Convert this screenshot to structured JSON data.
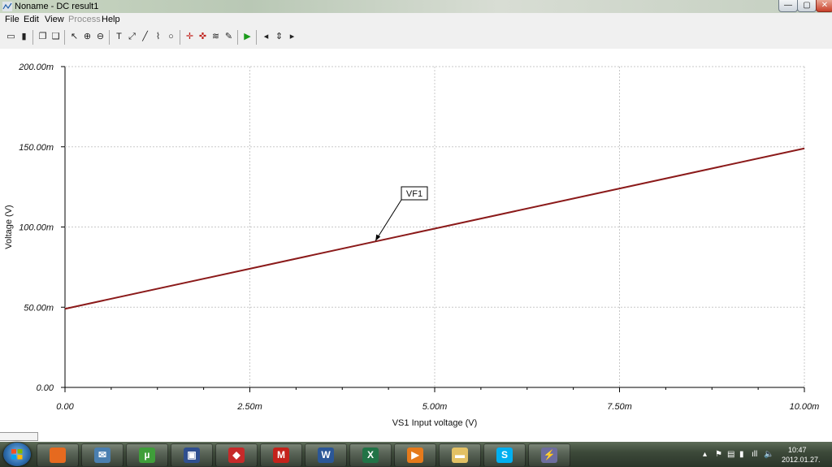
{
  "window": {
    "title": "Noname - DC result1",
    "buttons": {
      "minimize": "—",
      "maximize": "▢",
      "close": "✕"
    }
  },
  "menu": {
    "items": [
      {
        "label": "File",
        "enabled": true
      },
      {
        "label": "Edit",
        "enabled": true
      },
      {
        "label": "View",
        "enabled": true
      },
      {
        "label": "Process",
        "enabled": false
      },
      {
        "label": "Help",
        "enabled": true
      }
    ]
  },
  "toolbar": {
    "icons": [
      "open-icon",
      "save-icon",
      "copy-icon",
      "paste-icon",
      "pointer-icon",
      "zoom-in-icon",
      "zoom-out-icon",
      "text-icon",
      "marker-icon",
      "line-icon",
      "cursor-line-icon",
      "circle-icon",
      "cross-cursor-icon",
      "cursor-pair-icon",
      "curve-icon",
      "probe-icon",
      "run-icon",
      "step-back-icon",
      "step-updown-icon",
      "step-forward-icon"
    ],
    "glyphs": [
      "▭",
      "▮",
      "❐",
      "❑",
      "↖",
      "⊕",
      "⊖",
      "T",
      "⤢",
      "╱",
      "⌇",
      "○",
      "✛",
      "✜",
      "≋",
      "✎",
      "▶",
      "◂",
      "⇕",
      "▸"
    ]
  },
  "chart_data": {
    "type": "line",
    "xlabel": "VS1 Input voltage (V)",
    "ylabel": "Voltage (V)",
    "x_ticks": [
      "0.00",
      "2.50m",
      "5.00m",
      "7.50m",
      "10.00m"
    ],
    "y_ticks": [
      "0.00",
      "50.00m",
      "100.00m",
      "150.00m",
      "200.00m"
    ],
    "xlim": [
      0,
      0.01
    ],
    "ylim": [
      0,
      0.2
    ],
    "grid": true,
    "series": [
      {
        "name": "VF1",
        "color": "#8b1a1a",
        "x": [
          0,
          0.0025,
          0.005,
          0.0075,
          0.01
        ],
        "y": [
          0.049,
          0.074,
          0.099,
          0.124,
          0.149
        ]
      }
    ],
    "annotation": {
      "text": "VF1",
      "target_x": 0.0042,
      "target_y": 0.0914
    }
  },
  "taskbar": {
    "apps": [
      {
        "name": "firefox-icon",
        "glyph": "",
        "color": "#e66a1f"
      },
      {
        "name": "mail-icon",
        "glyph": "✉",
        "color": "#4a7fb0"
      },
      {
        "name": "utorrent-icon",
        "glyph": "µ",
        "color": "#3f9e3a"
      },
      {
        "name": "floppy-icon",
        "glyph": "▣",
        "color": "#2f4f8f"
      },
      {
        "name": "app-red-icon",
        "glyph": "◆",
        "color": "#c62a2a"
      },
      {
        "name": "microchip-icon",
        "glyph": "M",
        "color": "#c4221b"
      },
      {
        "name": "word-icon",
        "glyph": "W",
        "color": "#2b5797"
      },
      {
        "name": "excel-icon",
        "glyph": "X",
        "color": "#217346"
      },
      {
        "name": "media-icon",
        "glyph": "▶",
        "color": "#e57a1b"
      },
      {
        "name": "folder-icon",
        "glyph": "▬",
        "color": "#e3c164"
      },
      {
        "name": "skype-icon",
        "glyph": "S",
        "color": "#00aff0"
      },
      {
        "name": "tina-icon",
        "glyph": "⚡",
        "color": "#6d6d9e"
      }
    ],
    "tray": [
      "▴",
      "⚑",
      "▤",
      "▮",
      "ıll",
      "🔈"
    ],
    "clock_time": "10:47",
    "clock_date": "2012.01.27."
  }
}
